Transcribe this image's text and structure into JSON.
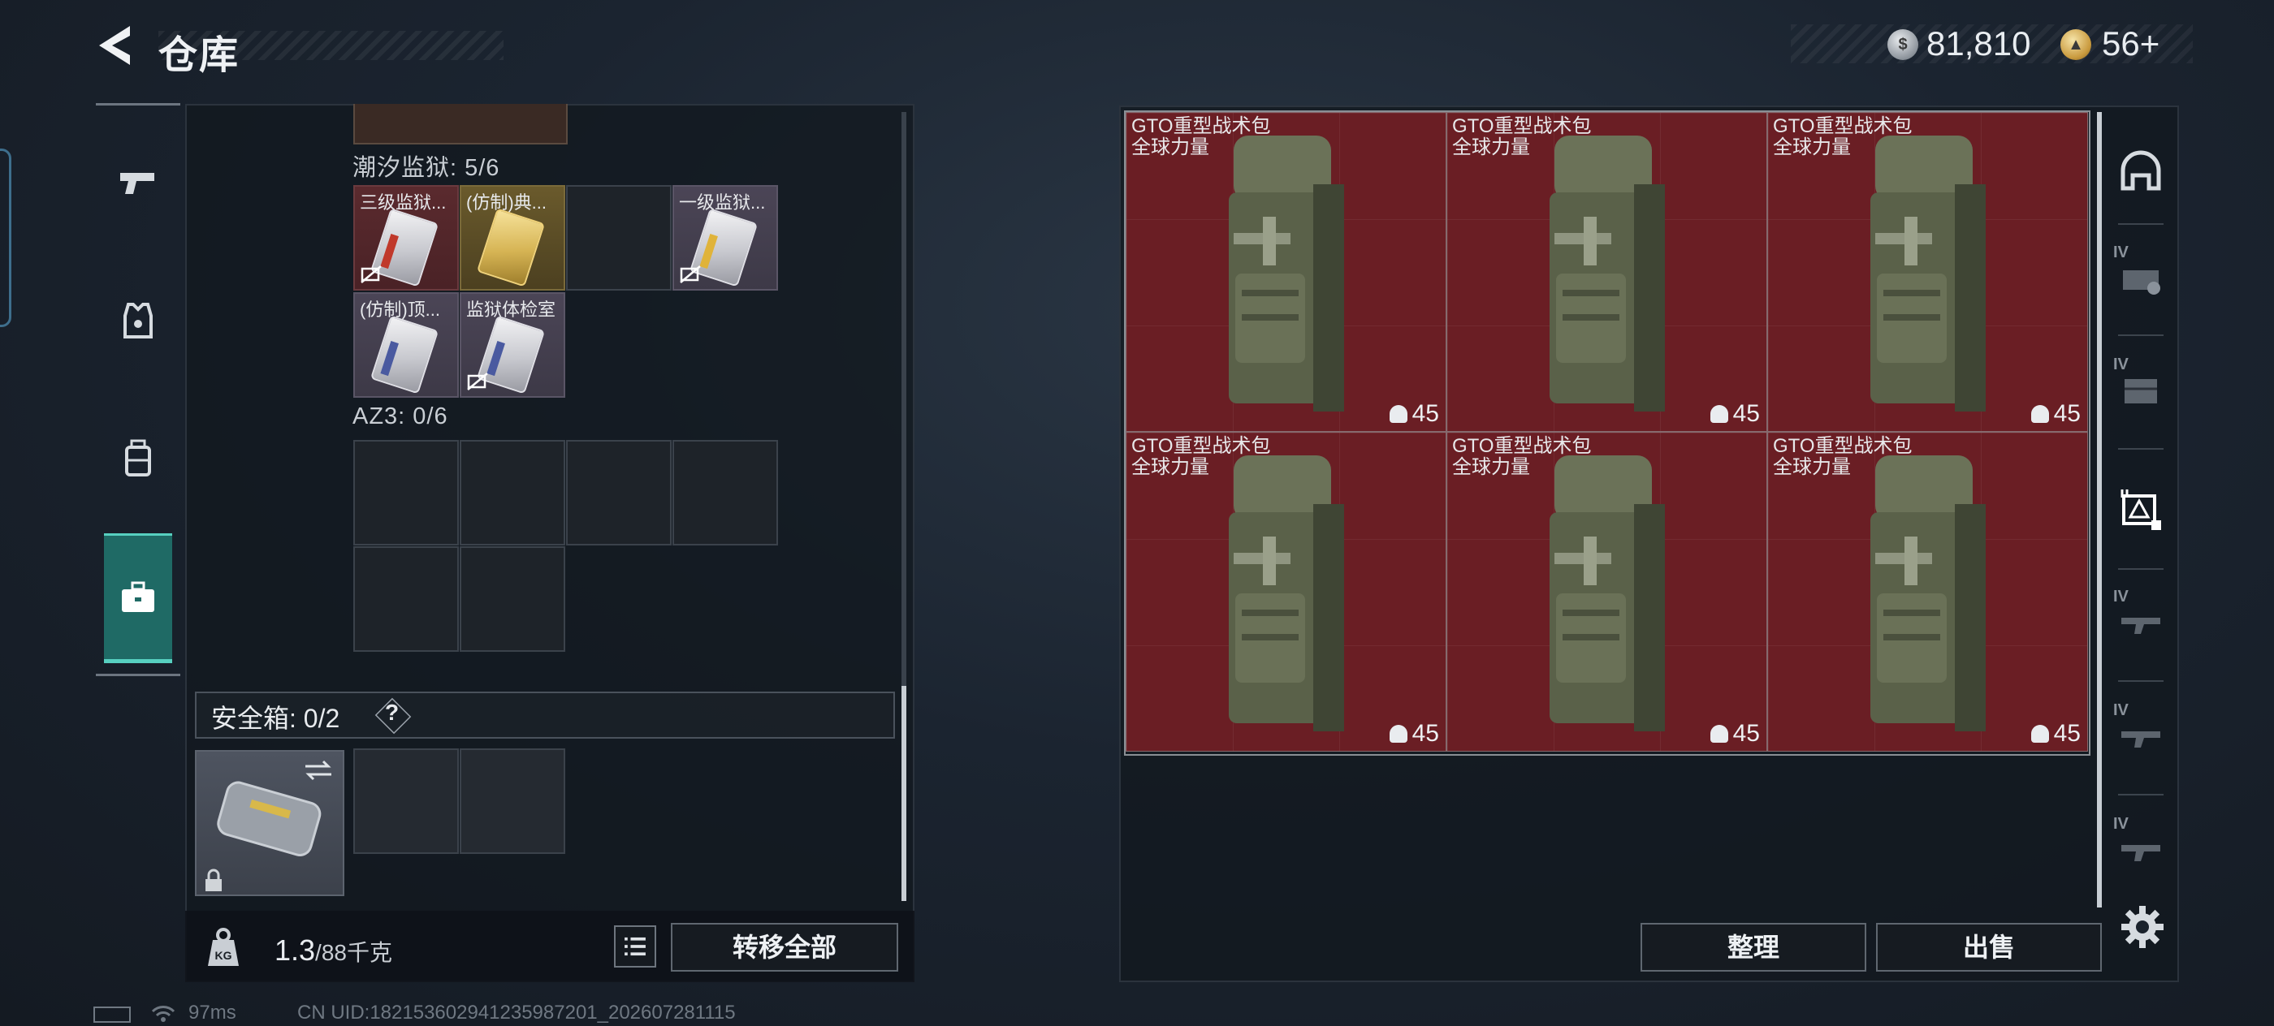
{
  "header": {
    "title": "仓库",
    "silver_amount": "81,810",
    "gold_amount": "56+"
  },
  "left_rail": {
    "tabs": [
      {
        "icon": "pistol-icon"
      },
      {
        "icon": "armor-vest-icon"
      },
      {
        "icon": "backpack-icon"
      },
      {
        "icon": "briefcase-icon",
        "active": true
      }
    ]
  },
  "containers": [
    {
      "label": "潮汐监狱: 5/6",
      "items": [
        {
          "name": "三级监狱...",
          "card": "red",
          "no_drop": true
        },
        {
          "name": "(仿制)典...",
          "card": "gold",
          "no_drop": false
        },
        {
          "name": "",
          "card": "empty"
        },
        {
          "name": "一级监狱...",
          "card": "yellow",
          "no_drop": true
        },
        {
          "name": "(仿制)顶...",
          "card": "blue",
          "no_drop": false
        },
        {
          "name": "监狱体检室",
          "card": "blue",
          "no_drop": true
        }
      ]
    },
    {
      "label": "AZ3: 0/6"
    }
  ],
  "safe_box": {
    "label": "安全箱: 0/2",
    "help": "?"
  },
  "footer": {
    "weight_current": "1.3",
    "weight_max": "/88千克",
    "transfer_all": "转移全部",
    "sort": "整理",
    "sell": "出售"
  },
  "bags": [
    {
      "name": "GTO重型战术包",
      "subtitle": "全球力量",
      "value": "45"
    },
    {
      "name": "GTO重型战术包",
      "subtitle": "全球力量",
      "value": "45"
    },
    {
      "name": "GTO重型战术包",
      "subtitle": "全球力量",
      "value": "45"
    },
    {
      "name": "GTO重型战术包",
      "subtitle": "全球力量",
      "value": "45"
    },
    {
      "name": "GTO重型战术包",
      "subtitle": "全球力量",
      "value": "45"
    },
    {
      "name": "GTO重型战术包",
      "subtitle": "全球力量",
      "value": "45"
    }
  ],
  "right_rail": {
    "tier_label": "IV",
    "tabs": [
      "helmet-icon",
      "armor-tier-icon",
      "chest-rig-icon",
      "backpack-tier-icon",
      "weapon-tier-icon",
      "weapon-tier-icon",
      "weapon-tier-icon"
    ]
  },
  "status": {
    "ping": "97ms",
    "uid": "CN UID:1821536029412359872​01_202607281115"
  },
  "colors": {
    "accent": "#57d0c0",
    "bag_bg": "#6a1e24",
    "panel_bg": "#12181f"
  }
}
